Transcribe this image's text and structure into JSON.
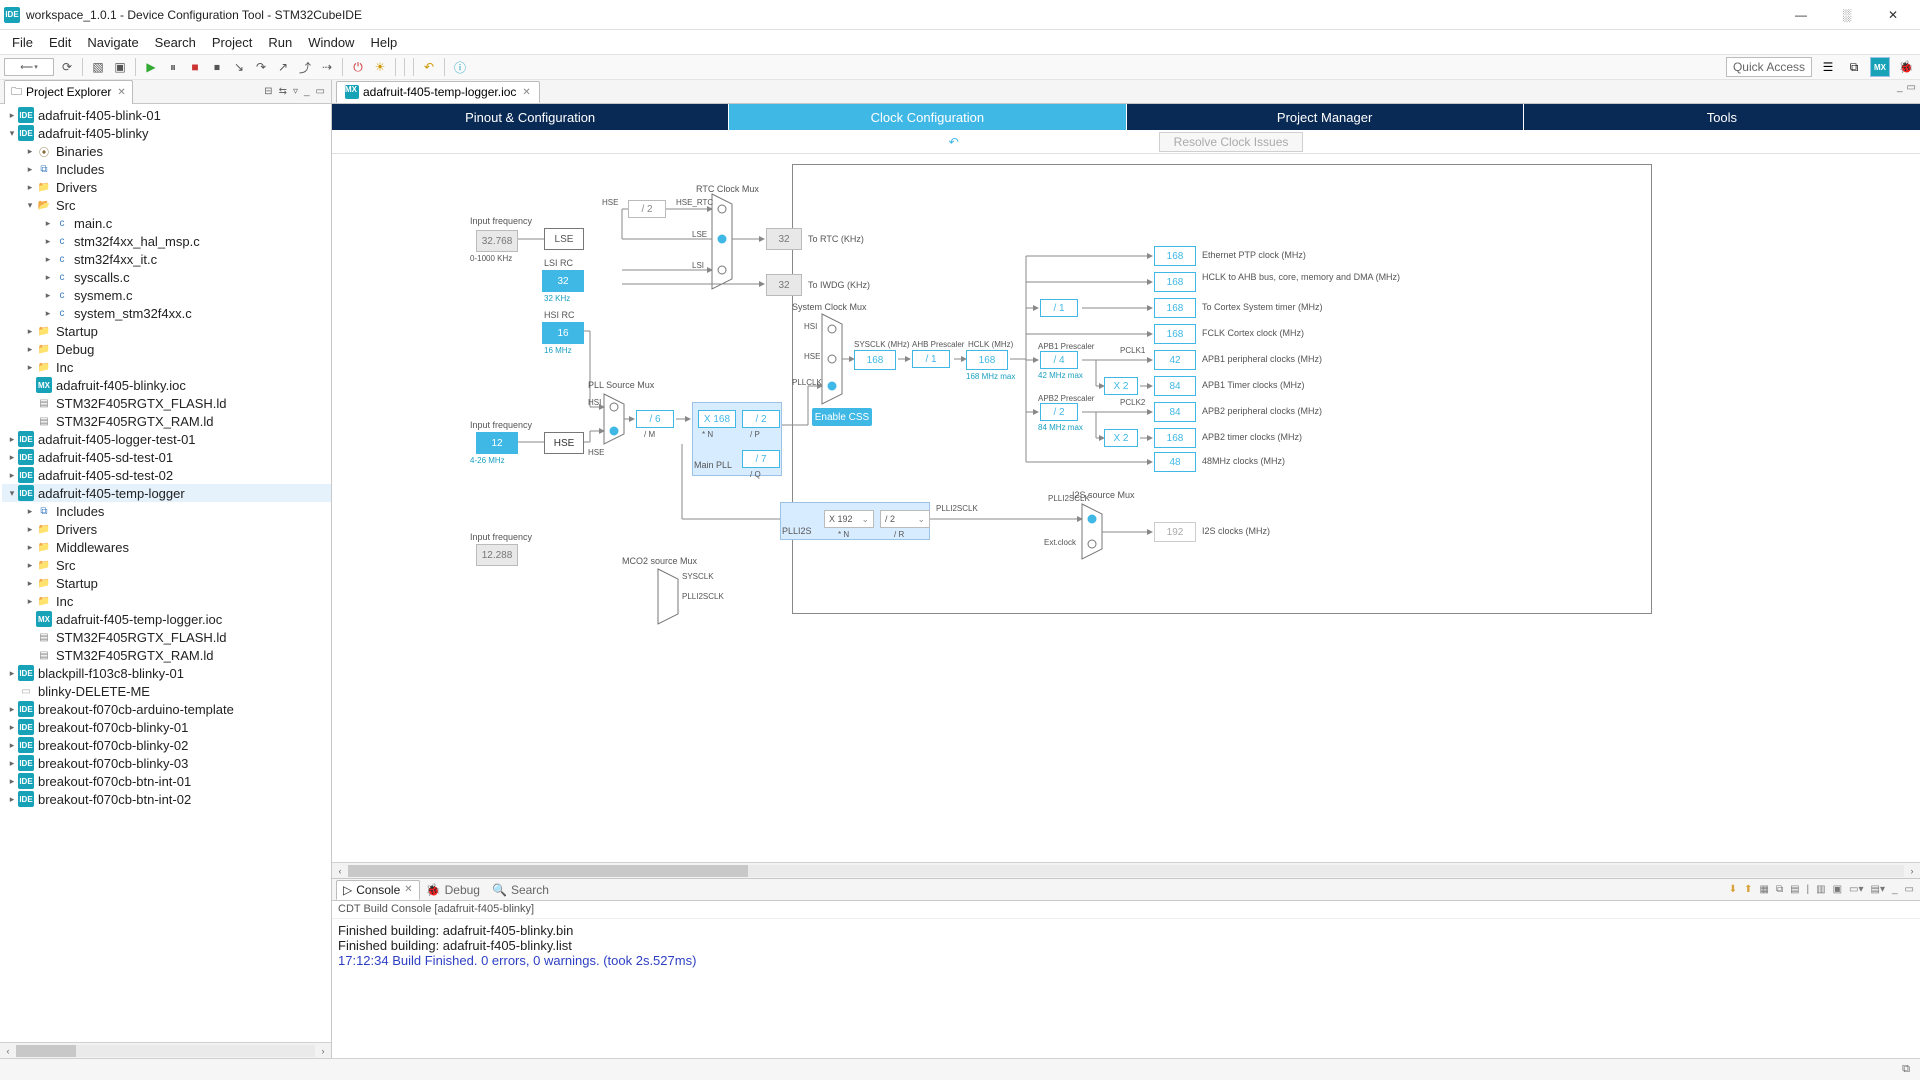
{
  "title": "workspace_1.0.1 - Device Configuration Tool - STM32CubeIDE",
  "menu": [
    "File",
    "Edit",
    "Navigate",
    "Search",
    "Project",
    "Run",
    "Window",
    "Help"
  ],
  "quick_access": "Quick Access",
  "explorer": {
    "title": "Project Explorer",
    "tree": [
      {
        "d": 0,
        "tw": "▸",
        "ic": "proj",
        "t": "IDE",
        "l": "adafruit-f405-blink-01"
      },
      {
        "d": 0,
        "tw": "▾",
        "ic": "proj",
        "t": "IDE",
        "l": "adafruit-f405-blinky"
      },
      {
        "d": 1,
        "tw": "▸",
        "ic": "bin",
        "t": "⦿",
        "l": "Binaries"
      },
      {
        "d": 1,
        "tw": "▸",
        "ic": "inc",
        "t": "⧉",
        "l": "Includes"
      },
      {
        "d": 1,
        "tw": "▸",
        "ic": "fold",
        "t": "📁",
        "l": "Drivers"
      },
      {
        "d": 1,
        "tw": "▾",
        "ic": "fold",
        "t": "📂",
        "l": "Src"
      },
      {
        "d": 2,
        "tw": "▸",
        "ic": "cfile",
        "t": "c",
        "l": "main.c"
      },
      {
        "d": 2,
        "tw": "▸",
        "ic": "cfile",
        "t": "c",
        "l": "stm32f4xx_hal_msp.c"
      },
      {
        "d": 2,
        "tw": "▸",
        "ic": "cfile",
        "t": "c",
        "l": "stm32f4xx_it.c"
      },
      {
        "d": 2,
        "tw": "▸",
        "ic": "cfile",
        "t": "c",
        "l": "syscalls.c"
      },
      {
        "d": 2,
        "tw": "▸",
        "ic": "cfile",
        "t": "c",
        "l": "sysmem.c"
      },
      {
        "d": 2,
        "tw": "▸",
        "ic": "cfile",
        "t": "c",
        "l": "system_stm32f4xx.c"
      },
      {
        "d": 1,
        "tw": "▸",
        "ic": "fold",
        "t": "📁",
        "l": "Startup"
      },
      {
        "d": 1,
        "tw": "▸",
        "ic": "foldc",
        "t": "📁",
        "l": "Debug"
      },
      {
        "d": 1,
        "tw": "▸",
        "ic": "foldc",
        "t": "📁",
        "l": "Inc"
      },
      {
        "d": 1,
        "tw": "",
        "ic": "ioc",
        "t": "MX",
        "l": "adafruit-f405-blinky.ioc"
      },
      {
        "d": 1,
        "tw": "",
        "ic": "ld",
        "t": "▤",
        "l": "STM32F405RGTX_FLASH.ld"
      },
      {
        "d": 1,
        "tw": "",
        "ic": "ld",
        "t": "▤",
        "l": "STM32F405RGTX_RAM.ld"
      },
      {
        "d": 0,
        "tw": "▸",
        "ic": "proj",
        "t": "IDE",
        "l": "adafruit-f405-logger-test-01"
      },
      {
        "d": 0,
        "tw": "▸",
        "ic": "proj",
        "t": "IDE",
        "l": "adafruit-f405-sd-test-01"
      },
      {
        "d": 0,
        "tw": "▸",
        "ic": "proj",
        "t": "IDE",
        "l": "adafruit-f405-sd-test-02"
      },
      {
        "d": 0,
        "tw": "▾",
        "ic": "proj",
        "t": "IDE",
        "l": "adafruit-f405-temp-logger",
        "sel": true
      },
      {
        "d": 1,
        "tw": "▸",
        "ic": "inc",
        "t": "⧉",
        "l": "Includes"
      },
      {
        "d": 1,
        "tw": "▸",
        "ic": "fold",
        "t": "📁",
        "l": "Drivers"
      },
      {
        "d": 1,
        "tw": "▸",
        "ic": "fold",
        "t": "📁",
        "l": "Middlewares"
      },
      {
        "d": 1,
        "tw": "▸",
        "ic": "fold",
        "t": "📁",
        "l": "Src"
      },
      {
        "d": 1,
        "tw": "▸",
        "ic": "fold",
        "t": "📁",
        "l": "Startup"
      },
      {
        "d": 1,
        "tw": "▸",
        "ic": "foldc",
        "t": "📁",
        "l": "Inc"
      },
      {
        "d": 1,
        "tw": "",
        "ic": "ioc",
        "t": "MX",
        "l": "adafruit-f405-temp-logger.ioc"
      },
      {
        "d": 1,
        "tw": "",
        "ic": "ld",
        "t": "▤",
        "l": "STM32F405RGTX_FLASH.ld"
      },
      {
        "d": 1,
        "tw": "",
        "ic": "ld",
        "t": "▤",
        "l": "STM32F405RGTX_RAM.ld"
      },
      {
        "d": 0,
        "tw": "▸",
        "ic": "proj",
        "t": "IDE",
        "l": "blackpill-f103c8-blinky-01"
      },
      {
        "d": 0,
        "tw": "",
        "ic": "del",
        "t": "▭",
        "l": "blinky-DELETE-ME"
      },
      {
        "d": 0,
        "tw": "▸",
        "ic": "proj",
        "t": "IDE",
        "l": "breakout-f070cb-arduino-template"
      },
      {
        "d": 0,
        "tw": "▸",
        "ic": "proj",
        "t": "IDE",
        "l": "breakout-f070cb-blinky-01"
      },
      {
        "d": 0,
        "tw": "▸",
        "ic": "proj",
        "t": "IDE",
        "l": "breakout-f070cb-blinky-02"
      },
      {
        "d": 0,
        "tw": "▸",
        "ic": "proj",
        "t": "IDE",
        "l": "breakout-f070cb-blinky-03"
      },
      {
        "d": 0,
        "tw": "▸",
        "ic": "proj",
        "t": "IDE",
        "l": "breakout-f070cb-btn-int-01"
      },
      {
        "d": 0,
        "tw": "▸",
        "ic": "proj",
        "t": "IDE",
        "l": "breakout-f070cb-btn-int-02"
      }
    ]
  },
  "editor": {
    "tab": {
      "icon": "MX",
      "label": "adafruit-f405-temp-logger.ioc"
    },
    "cfg_tabs": [
      "Pinout & Configuration",
      "Clock Configuration",
      "Project Manager",
      "Tools"
    ],
    "cfg_active": 1,
    "resolve": "Resolve Clock Issues"
  },
  "clock": {
    "lse_in_label": "Input frequency",
    "lse_in": "32.768",
    "lse_in_range": "0-1000 KHz",
    "lse": "LSE",
    "lsi": "LSI RC",
    "lsi_val": "32",
    "lsi_unit": "32 KHz",
    "hsi": "HSI RC",
    "hsi_val": "16",
    "hsi_unit": "16 MHz",
    "hse_in_label": "Input frequency",
    "hse_in": "12",
    "hse_in_range": "4-26 MHz",
    "hse": "HSE",
    "i2s_in_label": "Input frequency",
    "i2s_in": "12.288",
    "rtc_mux": "RTC Clock Mux",
    "hse_rtc_lbl": "HSE_RTC",
    "hse_rtc": "/ 2",
    "rtc_to": "To RTC (KHz)",
    "rtc_val": "32",
    "lse_lbl": "LSE",
    "lsi_lbl": "LSI",
    "iwdg_to": "To IWDG (KHz)",
    "iwdg_val": "32",
    "pll_src": "PLL Source Mux",
    "hsi_lbl": "HSI",
    "hse_lbl": "HSE",
    "pll_m": "/ 6",
    "pll_m_lbl": "/ M",
    "main_pll": "Main PLL",
    "pll_n": "X 168",
    "pll_n_lbl": "* N",
    "pll_p": "/ 2",
    "pll_p_lbl": "/ P",
    "pll_q": "/ 7",
    "pll_q_lbl": "/ Q",
    "enable_css": "Enable CSS",
    "sys_mux": "System Clock Mux",
    "sys_hsi": "HSI",
    "sys_hse": "HSE",
    "sys_pll": "PLLCLK",
    "sysclk_lbl": "SYSCLK (MHz)",
    "sysclk": "168",
    "ahb_lbl": "AHB Prescaler",
    "ahb": "/ 1",
    "hclk_lbl": "HCLK (MHz)",
    "hclk": "168",
    "hclk_max": "168 MHz max",
    "eth_lbl": "Ethernet PTP clock (MHz)",
    "eth": "168",
    "hbus_lbl": "HCLK to AHB bus, core, memory and DMA (MHz)",
    "hbus": "168",
    "cortex_div": "/ 1",
    "cortex_lbl": "To Cortex System timer (MHz)",
    "cortex": "168",
    "fclk_lbl": "FCLK Cortex clock (MHz)",
    "fclk": "168",
    "apb1_pre_lbl": "APB1 Prescaler",
    "apb1_pre": "/ 4",
    "apb1_max": "42 MHz max",
    "pclk1_lbl": "PCLK1",
    "apb1_lbl": "APB1 peripheral clocks (MHz)",
    "apb1": "42",
    "apb1t_mul": "X 2",
    "apb1t_lbl": "APB1 Timer clocks (MHz)",
    "apb1t": "84",
    "apb2_pre_lbl": "APB2 Prescaler",
    "apb2_pre": "/ 2",
    "apb2_max": "84 MHz max",
    "pclk2_lbl": "PCLK2",
    "apb2_lbl": "APB2 peripheral clocks (MHz)",
    "apb2": "84",
    "apb2t_mul": "X 2",
    "apb2t_lbl": "APB2 timer clocks (MHz)",
    "apb2t": "168",
    "mhz48_lbl": "48MHz clocks (MHz)",
    "mhz48": "48",
    "plli2s": "PLLI2S",
    "plli2s_n": "X 192",
    "plli2s_n_lbl": "* N",
    "plli2s_r": "/ 2",
    "plli2s_r_lbl": "/ R",
    "plli2sclk": "PLLI2SCLK",
    "ext": "Ext.clock",
    "i2s_src": "I2S source Mux",
    "i2s_lbl": "I2S clocks (MHz)",
    "i2s": "192",
    "mco2": "MCO2 source Mux",
    "mco2_sys": "SYSCLK",
    "mco2_plli2s": "PLLI2SCLK"
  },
  "console": {
    "tabs": [
      "Console",
      "Debug",
      "Search"
    ],
    "header": "CDT Build Console [adafruit-f405-blinky]",
    "lines": [
      {
        "t": "Finished building: adafruit-f405-blinky.bin",
        "c": ""
      },
      {
        "t": "",
        "c": ""
      },
      {
        "t": "Finished building: adafruit-f405-blinky.list",
        "c": ""
      },
      {
        "t": "",
        "c": ""
      },
      {
        "t": "",
        "c": ""
      },
      {
        "t": "17:12:34 Build Finished. 0 errors, 0 warnings. (took 2s.527ms)",
        "c": "finish"
      }
    ]
  }
}
